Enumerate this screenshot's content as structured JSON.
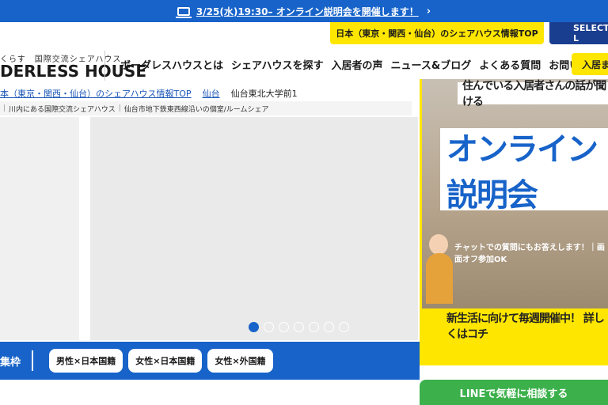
{
  "announcement": {
    "icon": "laptop-icon",
    "text": "3/25(水)19:30– オンライン説明会を開催します！",
    "chevron": "›"
  },
  "utility": {
    "info_top": "日本（東京・関西・仙台）のシェアハウス情報TOP",
    "select": "SELECT L"
  },
  "logo": {
    "tagline": "くらす　国際交流シェアハウス",
    "name": "DERLESS HOUSE"
  },
  "nav": {
    "items": [
      "ボーダレスハウスとは",
      "シェアハウスを探す",
      "入居者の声",
      "ニュース&ブログ",
      "よくある質問",
      "お問い合わせ"
    ],
    "cta": "入居ま"
  },
  "breadcrumb": {
    "items": [
      "本（東京・関西・仙台）のシェアハウス情報TOP",
      "仙台",
      "仙台東北大学前1"
    ]
  },
  "subtags": [
    "川内にある国際交流シェアハウス",
    "仙台市地下鉄東西線沿いの個室/ルームシェア"
  ],
  "slider": {
    "dots": 7,
    "active": 0
  },
  "filter": {
    "label": "集枠",
    "chips": [
      "男性×日本国籍",
      "女性×日本国籍",
      "女性×外国籍"
    ]
  },
  "banner": {
    "top_text": "住んでいる入居者さんの話が聞ける",
    "big_text": "オンライン説明会",
    "chat_text": "チャットでの質問にもお答えします！｜画面オフ参加OK",
    "bottom_text": "新生活に向けて毎週開催中！ 詳しくはコチ"
  },
  "line_button": "LINEで気軽に相談する",
  "colors": {
    "brand_blue": "#1763c9",
    "yellow": "#ffe600",
    "line_green": "#3cb04b",
    "navy": "#1a3e8f"
  }
}
